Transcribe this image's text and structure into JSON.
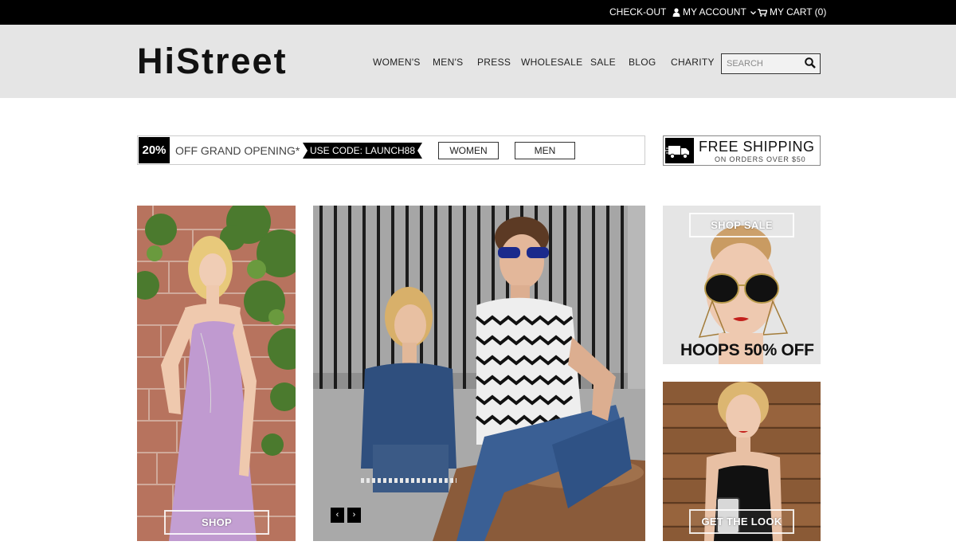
{
  "topbar": {
    "checkout": "CHECK-OUT",
    "account": "MY ACCOUNT",
    "cart": "MY CART (0)",
    "icons": [
      "user-icon",
      "chevron-down-icon",
      "cart-icon"
    ]
  },
  "header": {
    "logo": "HiStreet",
    "nav": [
      "WOMEN'S",
      "MEN'S",
      "PRESS",
      "WHOLESALE",
      "SALE",
      "BLOG",
      "CHARITY"
    ],
    "search_placeholder": "SEARCH",
    "search_icon": "search-icon"
  },
  "promo": {
    "percent": "20%",
    "text": "OFF GRAND OPENING*",
    "code": "USE CODE: LAUNCH88",
    "women_button": "WOMEN",
    "men_button": "MEN"
  },
  "shipping": {
    "title": "FREE SHIPPING",
    "subtitle": "ON ORDERS OVER $50",
    "icon": "truck-icon"
  },
  "tiles": {
    "left_button": "SHOP",
    "sale_button": "SHOP SALE",
    "sale_caption": "HOOPS 50% OFF",
    "look_button": "GET THE LOOK"
  },
  "slider": {
    "prev": "‹",
    "next": "›"
  },
  "colors": {
    "topbar": "#000000",
    "header_bg": "#e5e5e5",
    "accent": "#000000"
  }
}
